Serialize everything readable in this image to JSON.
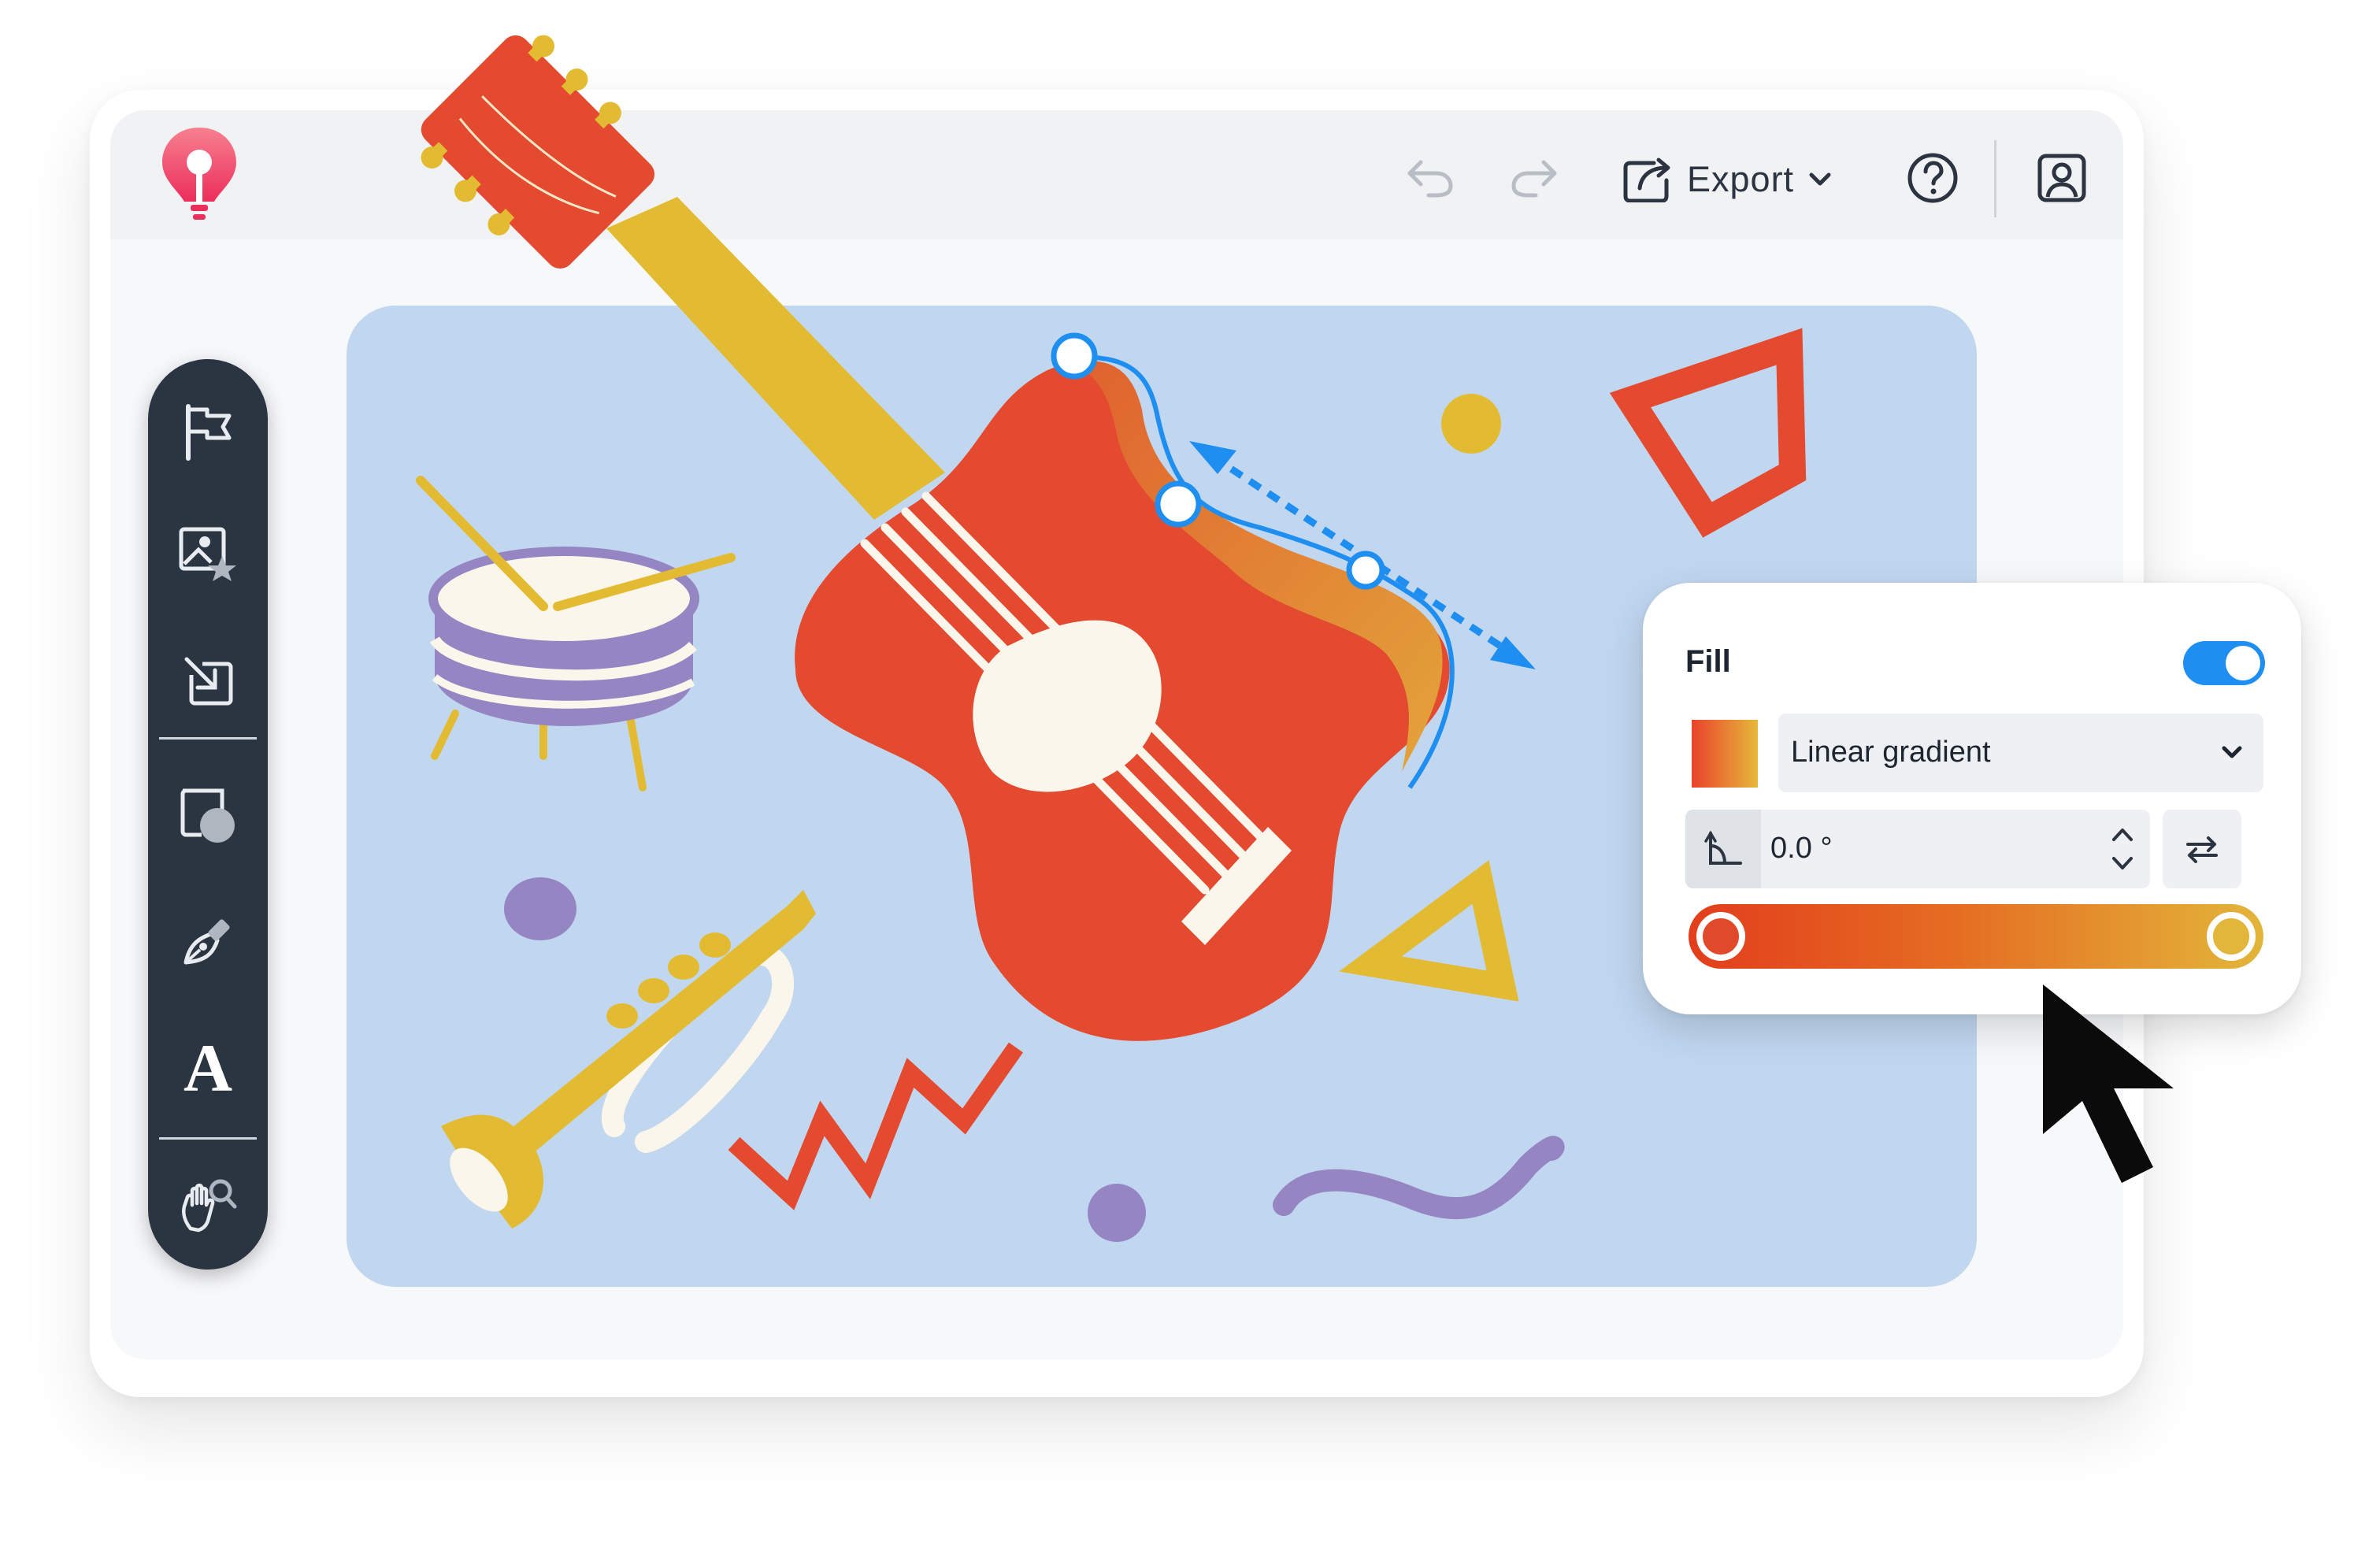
{
  "app": {
    "name": "",
    "logo_icon": "lightbulb-pin-logo",
    "brand_colors": {
      "logo_top": "#f56f84",
      "logo_bottom": "#ef3a62"
    }
  },
  "topbar": {
    "undo_icon": "undo-icon",
    "redo_icon": "redo-icon",
    "export_label": "Export",
    "export_icon": "share-out-icon",
    "help_icon": "help-circle-icon",
    "account_icon": "user-icon"
  },
  "toolbar": {
    "tools": [
      {
        "name": "flag-tool",
        "icon": "flag-icon"
      },
      {
        "name": "image-library-tool",
        "icon": "image-star-icon"
      },
      {
        "name": "import-tool",
        "icon": "import-icon"
      },
      {
        "name": "shapes-tool",
        "icon": "shapes-icon"
      },
      {
        "name": "pen-tool",
        "icon": "pen-nib-icon"
      },
      {
        "name": "text-tool",
        "icon": "text-icon",
        "glyph": "A"
      },
      {
        "name": "pan-zoom-tool",
        "icon": "hand-magnifier-icon"
      }
    ],
    "background": "#2b3542"
  },
  "canvas": {
    "background": "#c1d7f0",
    "artwork": [
      "guitar",
      "snare-drum",
      "trumpet",
      "triangle",
      "quadrilateral",
      "zigzag",
      "wave",
      "dots"
    ]
  },
  "fill_panel": {
    "title": "Fill",
    "enabled": true,
    "type_value": "Linear gradient",
    "angle_value": "0.0 °",
    "gradient": {
      "start_color": "#e23e1c",
      "end_color": "#e3b53a"
    },
    "accent": "#1e8ff0"
  }
}
